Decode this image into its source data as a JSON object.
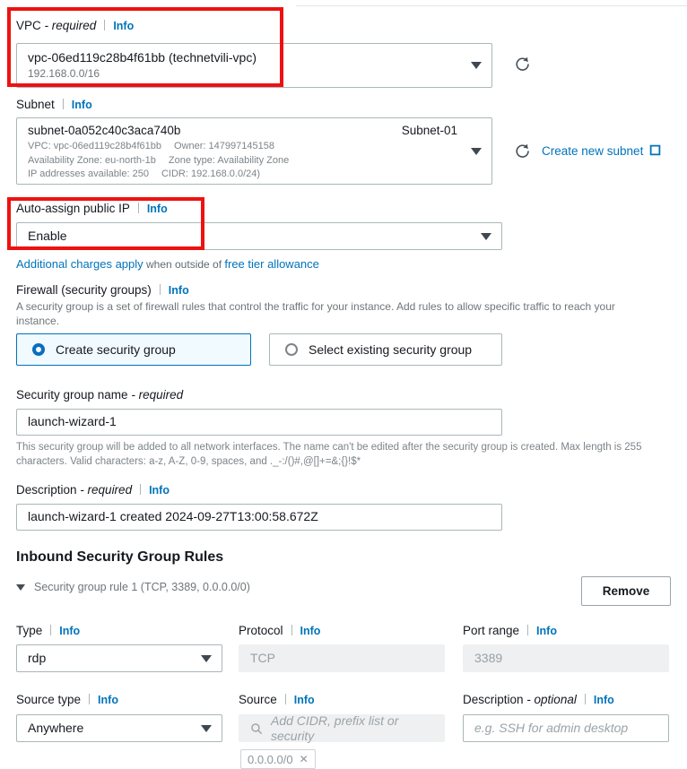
{
  "vpc": {
    "label": "VPC",
    "required_text": "- required",
    "info": "Info",
    "value_id": "vpc-06ed119c28b4f61bb (technetvili-vpc)",
    "value_cidr": "192.168.0.0/16",
    "refresh_icon": "refresh-icon"
  },
  "subnet": {
    "label": "Subnet",
    "info": "Info",
    "value_id": "subnet-0a052c40c3aca740b",
    "value_name": "Subnet-01",
    "meta_vpc": "VPC: vpc-06ed119c28b4f61bb",
    "meta_owner": "Owner: 147997145158",
    "meta_az": "Availability Zone: eu-north-1b",
    "meta_zone_type": "Zone type: Availability Zone",
    "meta_ips": "IP addresses available: 250",
    "meta_cidr": "CIDR: 192.168.0.0/24)",
    "refresh_icon": "refresh-icon",
    "create_link": "Create new subnet",
    "create_link_icon": "external-link-icon"
  },
  "auto_assign_ip": {
    "label": "Auto-assign public IP",
    "info": "Info",
    "value": "Enable",
    "charges_link": "Additional charges apply",
    "charges_mid": " when outside of ",
    "charges_link2": "free tier allowance"
  },
  "firewall": {
    "label": "Firewall (security groups)",
    "info": "Info",
    "description": "A security group is a set of firewall rules that control the traffic for your instance. Add rules to allow specific traffic to reach your instance.",
    "options": [
      {
        "label": "Create security group",
        "selected": true
      },
      {
        "label": "Select existing security group",
        "selected": false
      }
    ]
  },
  "security_group_name": {
    "label": "Security group name",
    "required_text": "- required",
    "value": "launch-wizard-1",
    "help": "This security group will be added to all network interfaces. The name can't be edited after the security group is created. Max length is 255 characters. Valid characters: a-z, A-Z, 0-9, spaces, and ._-:/()#,@[]+=&;{}!$*"
  },
  "description_field": {
    "label": "Description",
    "required_text": "- required",
    "info": "Info",
    "value": "launch-wizard-1 created 2024-09-27T13:00:58.672Z"
  },
  "inbound": {
    "title": "Inbound Security Group Rules",
    "rule_summary": "Security group rule 1 (TCP, 3389, 0.0.0.0/0)",
    "toggle_icon": "chevron-down-icon",
    "remove_label": "Remove",
    "type": {
      "label": "Type",
      "info": "Info",
      "value": "rdp"
    },
    "protocol": {
      "label": "Protocol",
      "info": "Info",
      "value": "TCP",
      "disabled": true
    },
    "port_range": {
      "label": "Port range",
      "info": "Info",
      "value": "3389",
      "disabled": true
    },
    "source_type": {
      "label": "Source type",
      "info": "Info",
      "value": "Anywhere"
    },
    "source": {
      "label": "Source",
      "info": "Info",
      "placeholder": "Add CIDR, prefix list or security",
      "search_icon": "search-icon",
      "chip_label": "0.0.0.0/0",
      "chip_remove_icon": "close-icon"
    },
    "rule_description": {
      "label": "Description",
      "optional_text": "- optional",
      "info": "Info",
      "placeholder": "e.g. SSH for admin desktop"
    }
  },
  "annotations": {
    "highlight_color": "#ee1111",
    "boxes": [
      "vpc-highlight",
      "auto-assign-ip-highlight"
    ]
  }
}
